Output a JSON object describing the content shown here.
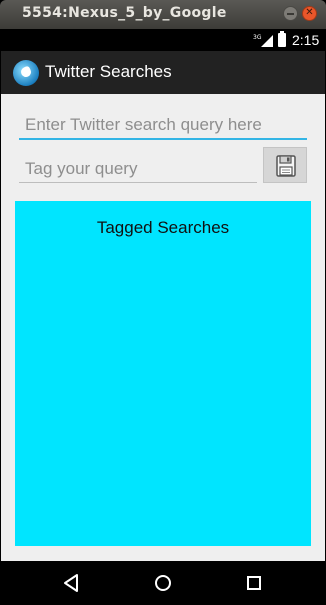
{
  "window": {
    "title": "5554:Nexus_5_by_Google",
    "minimize_icon": "minimize-icon",
    "close_icon": "close-icon",
    "close_glyph": "✕"
  },
  "status_bar": {
    "network": "3G",
    "time": "2:15"
  },
  "action_bar": {
    "title": "Twitter Searches"
  },
  "form": {
    "query_placeholder": "Enter Twitter search query here",
    "query_value": "",
    "tag_placeholder": "Tag your query",
    "tag_value": "",
    "save_icon": "floppy-disk-icon"
  },
  "tagged_searches": {
    "heading": "Tagged Searches",
    "items": []
  },
  "nav_bar": {
    "back_icon": "back-icon",
    "home_icon": "home-icon",
    "recents_icon": "recents-icon"
  },
  "colors": {
    "accent": "#33b5e5",
    "panel": "#00e5ff",
    "action_bar": "#222222",
    "background": "#efefef"
  }
}
